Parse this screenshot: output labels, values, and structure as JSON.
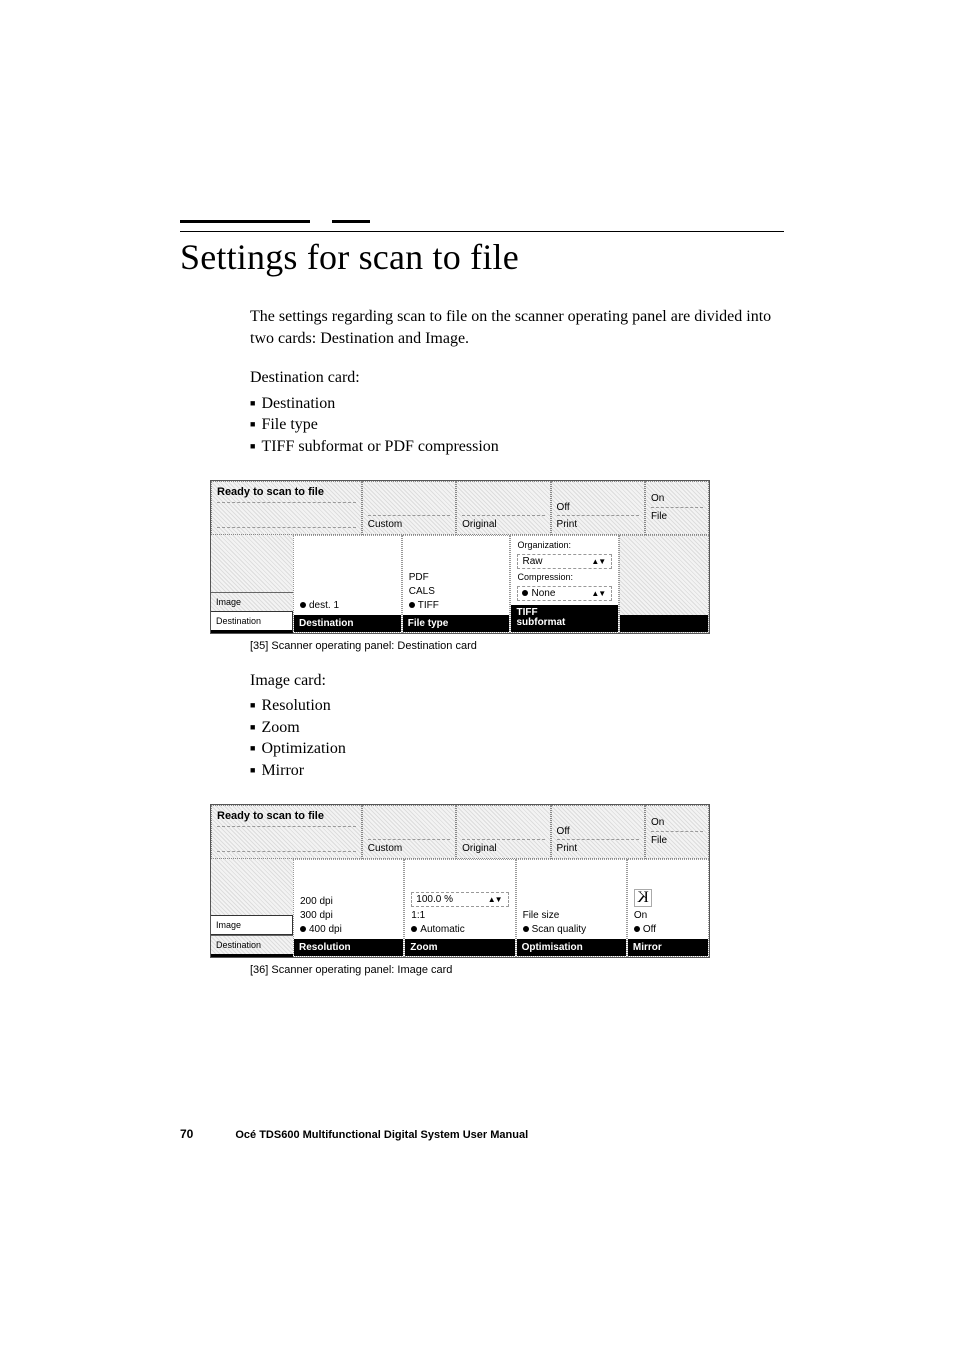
{
  "heading": "Settings for scan to file",
  "intro": "The settings regarding scan to file on the scanner operating panel are divided into two cards: Destination and Image.",
  "destination_card": {
    "title": "Destination card:",
    "items": [
      "Destination",
      "File type",
      "TIFF subformat or PDF compression"
    ]
  },
  "image_card": {
    "title": "Image card:",
    "items": [
      "Resolution",
      "Zoom",
      "Optimization",
      "Mirror"
    ]
  },
  "caption1": "[35] Scanner operating panel: Destination card",
  "caption2": "[36] Scanner operating panel: Image card",
  "panel_common": {
    "status": "Ready to scan to file",
    "top_labels": {
      "custom": "Custom",
      "original": "Original",
      "off": "Off",
      "print": "Print",
      "on": "On",
      "file": "File"
    },
    "tabs": {
      "image": "Image",
      "destination": "Destination"
    }
  },
  "panel1": {
    "col1": {
      "option": "dest. 1",
      "footer": "Destination"
    },
    "col2": {
      "options": [
        "PDF",
        "CALS",
        "TIFF"
      ],
      "selected": "TIFF",
      "footer": "File type"
    },
    "col3": {
      "org_label": "Organization:",
      "org_value": "Raw",
      "comp_label": "Compression:",
      "comp_value": "None",
      "footer_line1": "TIFF",
      "footer_line2": "subformat"
    }
  },
  "panel2": {
    "col1": {
      "options": [
        "200 dpi",
        "300 dpi",
        "400 dpi"
      ],
      "selected": "400 dpi",
      "footer": "Resolution"
    },
    "col2": {
      "input": "100.0 %",
      "options": [
        "1:1",
        "Automatic"
      ],
      "selected": "Automatic",
      "footer": "Zoom"
    },
    "col3": {
      "options": [
        "File size",
        "Scan quality"
      ],
      "selected": "Scan quality",
      "footer": "Optimisation"
    },
    "col4": {
      "options": [
        "On",
        "Off"
      ],
      "selected": "Off",
      "footer": "Mirror"
    }
  },
  "footer": {
    "page": "70",
    "doc": "Océ TDS600 Multifunctional Digital System User Manual"
  }
}
